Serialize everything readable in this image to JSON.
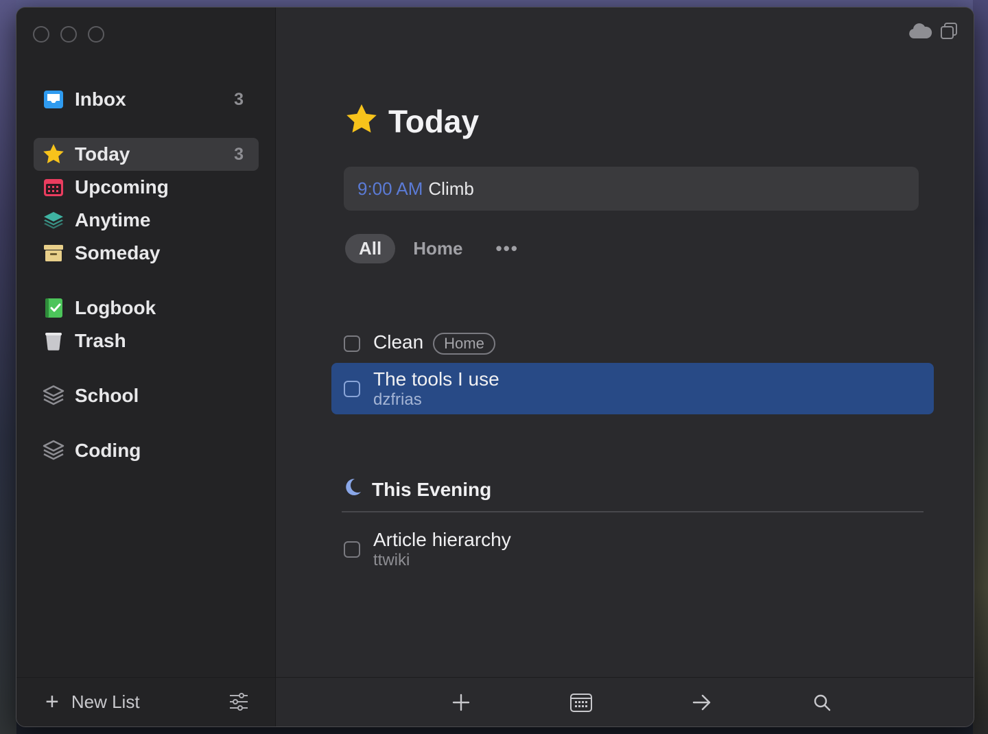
{
  "sidebar": {
    "items": [
      {
        "label": "Inbox",
        "count": "3",
        "icon": "inbox-icon"
      },
      {
        "label": "Today",
        "count": "3",
        "icon": "star-icon",
        "selected": true
      },
      {
        "label": "Upcoming",
        "icon": "calendar-icon"
      },
      {
        "label": "Anytime",
        "icon": "layers-icon"
      },
      {
        "label": "Someday",
        "icon": "archive-box-icon"
      },
      {
        "label": "Logbook",
        "icon": "logbook-icon"
      },
      {
        "label": "Trash",
        "icon": "trash-icon"
      },
      {
        "label": "School",
        "icon": "area-icon"
      },
      {
        "label": "Coding",
        "icon": "area-icon"
      }
    ],
    "footer": {
      "new_list_label": "New List"
    }
  },
  "main": {
    "title": "Today",
    "event": {
      "time": "9:00 AM",
      "title": "Climb"
    },
    "tags": {
      "all": "All",
      "home": "Home",
      "more": "•••"
    },
    "tasks": [
      {
        "title": "Clean",
        "tag": "Home"
      },
      {
        "title": "The tools I use",
        "subtitle": "dzfrias",
        "selected": true
      }
    ],
    "evening": {
      "header": "This Evening",
      "tasks": [
        {
          "title": "Article hierarchy",
          "subtitle": "ttwiki"
        }
      ]
    }
  },
  "colors": {
    "accent_selected": "#284a86",
    "event_time": "#5b7bd6",
    "inbox_blue": "#2f9bf0",
    "today_yellow": "#f7c31b",
    "upcoming_red": "#ea3d5f",
    "anytime_teal": "#3fb3a2",
    "someday_tan": "#e8cf8a",
    "logbook_green": "#4cc45a"
  }
}
